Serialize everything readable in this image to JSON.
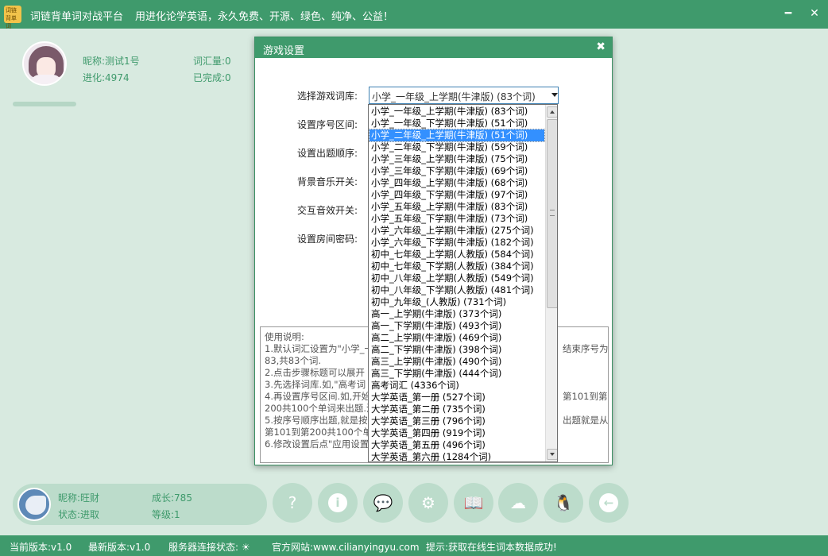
{
  "app": {
    "logo_line1": "词链",
    "logo_line2": "背单词",
    "name": "词链背单词对战平台",
    "slogan": "用进化论学英语，永久免费、开源、绿色、纯净、公益！",
    "minimize_glyph": "━",
    "close_glyph": "✕"
  },
  "user": {
    "nickname": "昵称:测试1号",
    "evolution": "进化:4974",
    "vocab_count": "词汇量:0",
    "completed": "已完成:0"
  },
  "dialog": {
    "title": "游戏设置",
    "close_glyph": "✖",
    "labels": {
      "wordbook": "选择游戏词库:",
      "range": "设置序号区间:",
      "order": "设置出题顺序:",
      "bgm": "背景音乐开关:",
      "sfx": "交互音效开关:",
      "password": "设置房间密码:"
    },
    "selected_wordbook": "小学_一年级_上学期(牛津版) (83个词)",
    "usage": {
      "title": "使用说明:",
      "line1": "1.默认词汇设置为\"小学_一",
      "line1_right": "结束序号为",
      "line2": "83,共83个词.",
      "line3": "2.点击步骤标题可以展开",
      "line4": "3.先选择词库.如,\"高考词",
      "line5": "4.再设置序号区间.如,开始",
      "line5_right": "第101到第",
      "line6": "200共100个单词来出题.注",
      "line7": "5.按序号顺序出题,就是按",
      "line7_right": "出题就是从",
      "line8": "第101到第200共100个单词",
      "line9": "6.修改设置后点\"应用设置"
    }
  },
  "dropdown": {
    "options": [
      "小学_一年级_上学期(牛津版) (83个词)",
      "小学_一年级_下学期(牛津版) (51个词)",
      "小学_二年级_上学期(牛津版) (51个词)",
      "小学_二年级_下学期(牛津版) (59个词)",
      "小学_三年级_上学期(牛津版) (75个词)",
      "小学_三年级_下学期(牛津版) (69个词)",
      "小学_四年级_上学期(牛津版) (68个词)",
      "小学_四年级_下学期(牛津版) (97个词)",
      "小学_五年级_上学期(牛津版) (83个词)",
      "小学_五年级_下学期(牛津版) (73个词)",
      "小学_六年级_上学期(牛津版) (275个词)",
      "小学_六年级_下学期(牛津版) (182个词)",
      "初中_七年级_上学期(人教版) (584个词)",
      "初中_七年级_下学期(人教版) (384个词)",
      "初中_八年级_上学期(人教版) (549个词)",
      "初中_八年级_下学期(人教版) (481个词)",
      "初中_九年级_(人教版) (731个词)",
      "高一_上学期(牛津版) (373个词)",
      "高一_下学期(牛津版) (493个词)",
      "高二_上学期(牛津版) (469个词)",
      "高二_下学期(牛津版) (398个词)",
      "高三_上学期(牛津版) (490个词)",
      "高三_下学期(牛津版) (444个词)",
      "高考词汇 (4336个词)",
      "大学英语_第一册 (527个词)",
      "大学英语_第二册 (735个词)",
      "大学英语_第三册 (796个词)",
      "大学英语_第四册 (919个词)",
      "大学英语_第五册 (496个词)",
      "大学英语_第六册 (1284个词)"
    ],
    "highlighted_index": 2
  },
  "pet": {
    "nickname": "昵称:旺财",
    "growth": "成长:785",
    "status": "状态:进取",
    "level": "等级:1"
  },
  "toolbar": {
    "help": "?",
    "info": "i",
    "chat": "💬",
    "settings": "⚙",
    "book": "📖",
    "cloud": "☁",
    "qq": "🐧",
    "back": "←"
  },
  "status": {
    "current_version": "当前版本:v1.0",
    "latest_version": "最新版本:v1.0",
    "server_status": "服务器连接状态: ☀",
    "website": "官方网站:www.cilianyingyu.com",
    "tip": "提示:获取在线生词本数据成功!"
  },
  "colors": {
    "primary": "#3f9a6c",
    "background": "#d8eae0",
    "card": "#bcdccb",
    "selection": "#3390ff"
  }
}
